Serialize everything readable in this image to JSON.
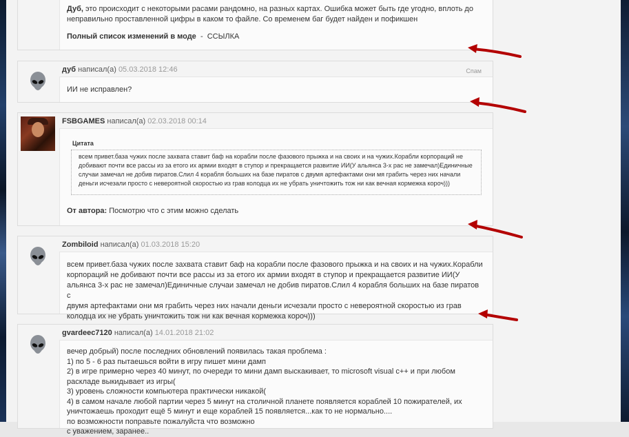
{
  "colors": {
    "arrow": "#b30000",
    "accent": "#333333"
  },
  "posts": [
    {
      "lines": [
        "Дуб, это происходит с некоторыми расами рандомно, на разных картах. Ошибка может быть где угодно, вплоть до",
        "неправильно проставленной цифры в каком то файле. Со временем баг будет найден и пофикшен"
      ],
      "first_word": "Дуб,",
      "list_label": "Полный список изменений в моде",
      "list_sep": "-",
      "list_link": "ССЫЛКА"
    },
    {
      "author": "дуб",
      "wrote": "написал(а)",
      "date": "05.03.2018 12:46",
      "spam": "Спам",
      "text": "ИИ не исправлен?",
      "avatar": "alien-icon"
    },
    {
      "author": "FSBGAMES",
      "wrote": "написал(а)",
      "date": "02.03.2018 00:14",
      "quote_label": "Цитата",
      "quote_lines": [
        "всем привет.база чужих после захвата ставит баф на корабли после фазового прыжка и на своих и на чужих.Корабли корпораций не",
        "добивают почти все рассы из за етого их армии входят в ступор и прекращается развитие ИИ(У альянса 3-х рас не замечал)Единичные",
        "случаи замечал не добив пиратов.Слил 4 корабля больших на базе пиратов с двумя артефактами они мя грабить через них начали",
        "деньги исчезали просто с невероятной скоростью из грав колодца их не убрать уничтожить тож ни как вечная кормежка короч)))"
      ],
      "author_reply_label": "От автора:",
      "author_reply": "Посмотрю что с этим можно сделать",
      "avatar": "user-photo"
    },
    {
      "author": "Zombiloid",
      "wrote": "написал(а)",
      "date": "01.03.2018 15:20",
      "lines": [
        "всем привет.база чужих после захвата ставит баф на корабли после фазового прыжка и на своих и на чужих.Корабли",
        "корпораций не добивают почти все рассы из за етого их армии входят в ступор и прекращается развитие ИИ(У",
        "альянса 3-х рас не замечал)Единичные случаи замечал не добив пиратов.Слил 4 корабля больших на базе пиратов с",
        "двумя артефактами они мя грабить через них начали деньги исчезали просто с невероятной скоростью из грав",
        "колодца их не убрать уничтожить тож ни как вечная кормежка короч)))"
      ],
      "avatar": "alien-icon"
    },
    {
      "author": "gvardeec7120",
      "wrote": "написал(а)",
      "date": "14.01.2018 21:02",
      "lines": [
        "вечер добрый) после последних обновлений появилась такая проблема :",
        "1) по 5 - 6 раз пытаешься войти в игру пишет мини дамп",
        "2) в игре примерно через 40 минут, по очереди то мини дамп выскакивает, то microsoft visual c++ и при любом",
        "раскладе выкидывает из игры(",
        "3) уровень сложности компьютера практически никакой(",
        "4) в самом начале любой партии через 5 минут на столичной планете появляется кораблей 10 пожирателей, их",
        "уничтожаешь проходит ещё 5 минут и еще кораблей 15 появляется...как то не нормально....",
        "по возможности поправьте пожалуйста что возможно",
        "с уважением, заранее.."
      ],
      "avatar": "alien-icon"
    }
  ]
}
